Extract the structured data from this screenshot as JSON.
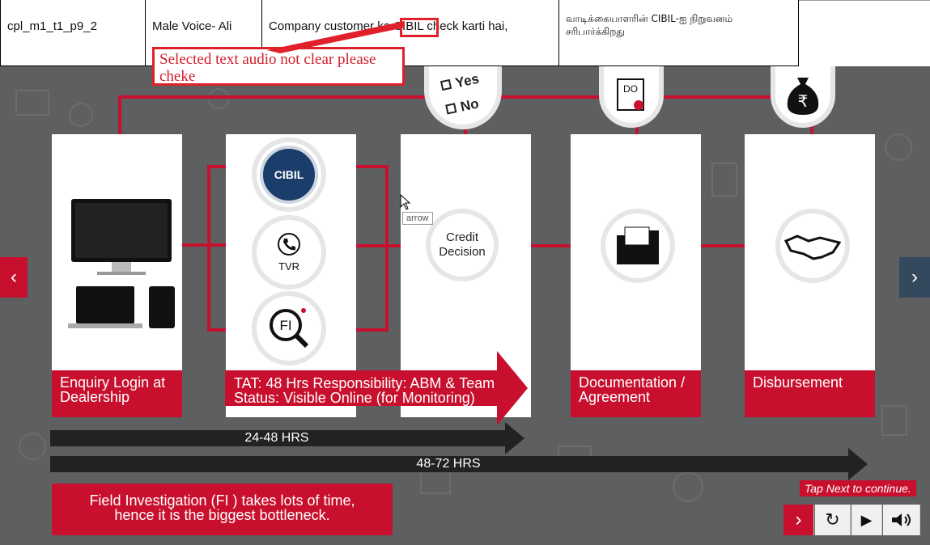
{
  "table": {
    "id": "cpl_m1_t1_p9_2",
    "voice": "Male Voice- Ali",
    "script": "Company customer ka CIBIL check karti hai,",
    "tamil": "வாடிக்கையாளரின் CIBIL-ஐ நிறுவனம் சரிபார்க்கிறது"
  },
  "annotation": {
    "text": "Selected text audio not clear please cheke"
  },
  "checklist": {
    "yes": "Yes",
    "no": "No"
  },
  "icons": {
    "do_label": "DO",
    "cibil_label": "CIBIL",
    "tvr_label": "TVR",
    "fi_label": "FI",
    "rupee": "₹"
  },
  "stages": {
    "enquiry": "Enquiry Login at Dealership",
    "tat": "TAT: 48 Hrs Responsibility: ABM & Team Status: Visible Online (for Monitoring)",
    "credit": "Credit Decision",
    "documentation": "Documentation / Agreement",
    "disbursement": "Disbursement"
  },
  "tooltip": "arrow",
  "timelines": {
    "short": "24-48 HRS",
    "long": "48-72 HRS"
  },
  "note": "Field Investigation (FI ) takes lots of time, hence it is the biggest bottleneck.",
  "hint": "Tap Next to continue.",
  "colors": {
    "accent": "#c8102e",
    "background": "#5e5f61",
    "nav_right": "#34495e"
  }
}
